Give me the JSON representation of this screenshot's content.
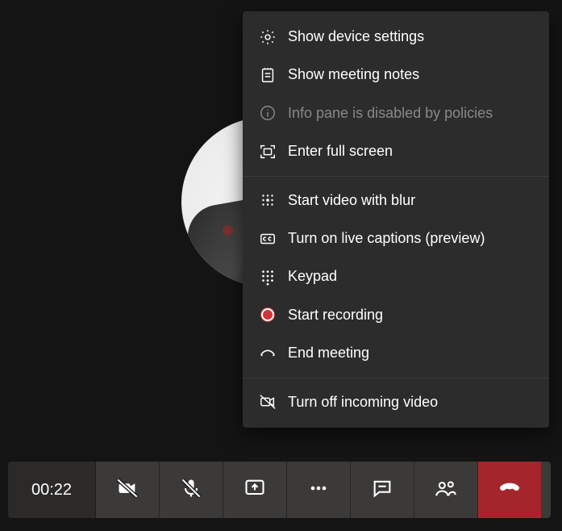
{
  "callTimer": "00:22",
  "menu": {
    "deviceSettings": "Show device settings",
    "meetingNotes": "Show meeting notes",
    "infoDisabled": "Info pane is disabled by policies",
    "fullScreen": "Enter full screen",
    "videoBlur": "Start video with blur",
    "liveCaptions": "Turn on live captions (preview)",
    "keypad": "Keypad",
    "startRecording": "Start recording",
    "endMeeting": "End meeting",
    "turnOffIncoming": "Turn off incoming video"
  }
}
